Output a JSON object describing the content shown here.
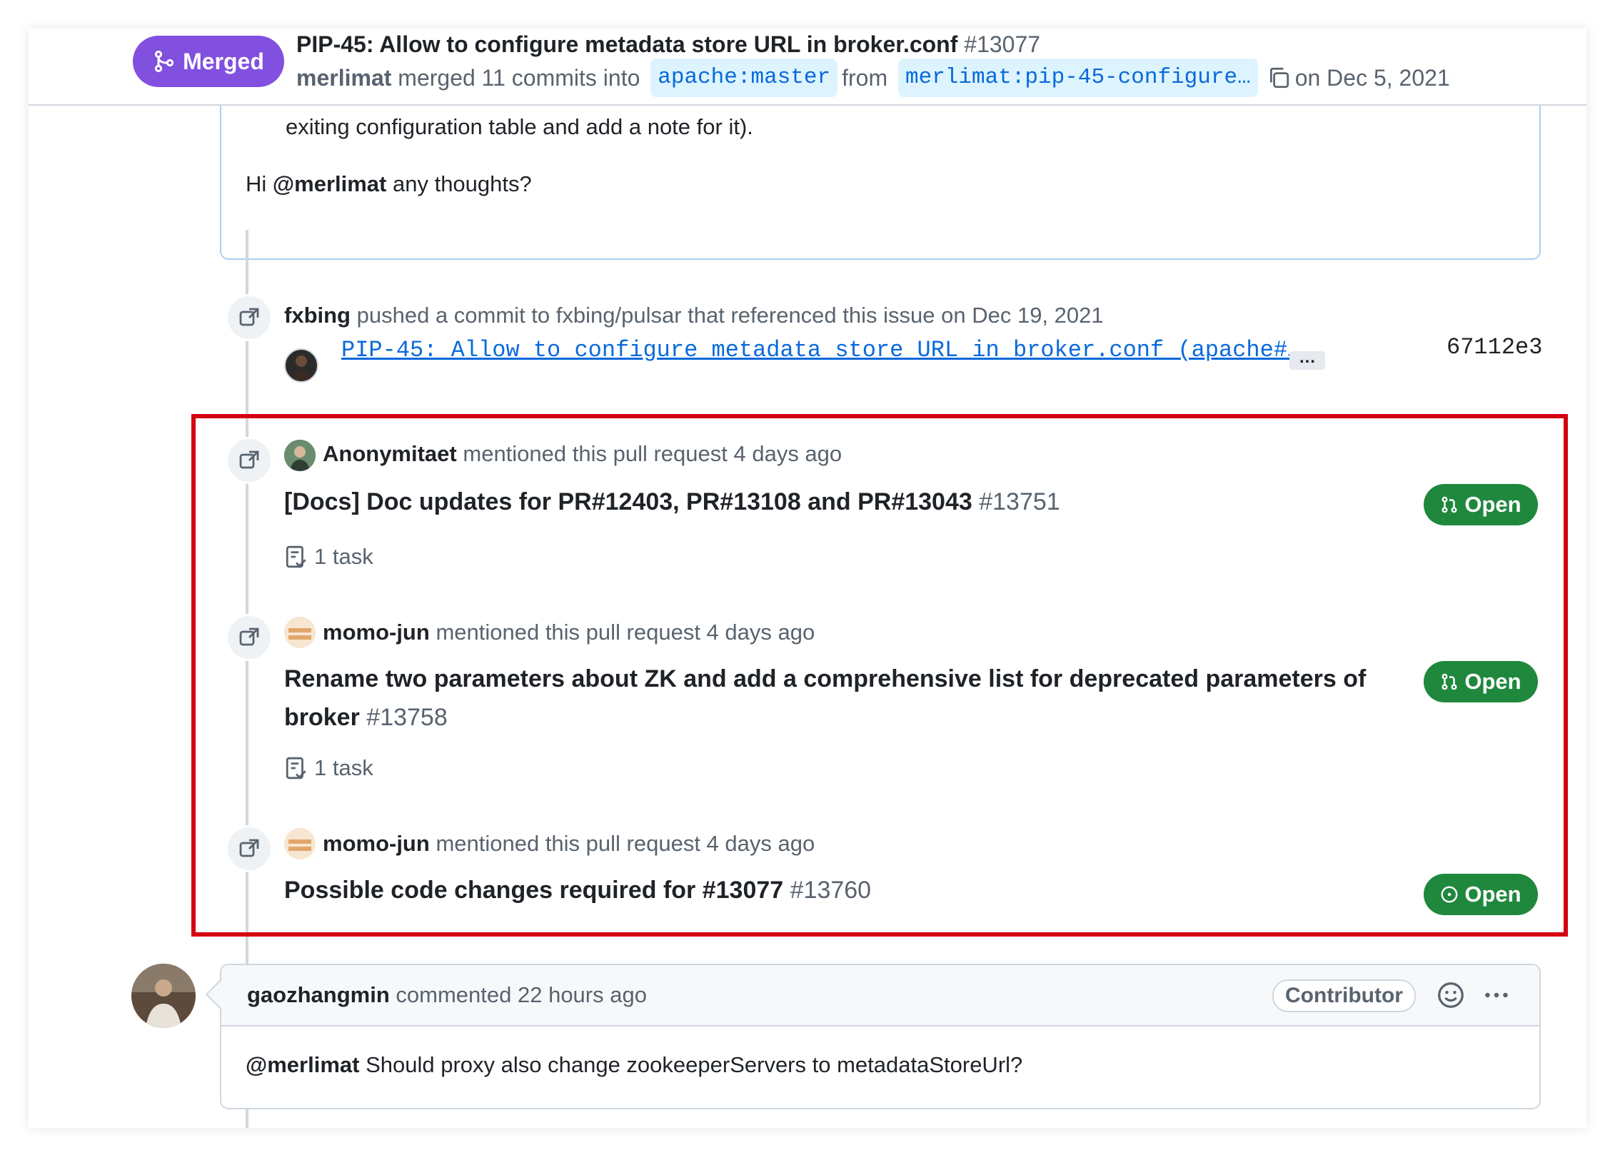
{
  "header": {
    "status_badge": "Merged",
    "title": "PIP-45: Allow to configure metadata store URL in broker.conf",
    "number": "#13077",
    "author": "merlimat",
    "merged_text": "merged 11 commits into",
    "base_branch": "apache:master",
    "from_text": "from",
    "head_branch": "merlimat:pip-45-configure…",
    "date_text": "on Dec 5, 2021"
  },
  "prev_comment": {
    "line1": "exiting configuration table and add a note for it).",
    "line2_prefix": "Hi",
    "line2_mention": "@merlimat",
    "line2_suffix": "any thoughts?"
  },
  "push_event": {
    "actor": "fxbing",
    "text": "pushed a commit to fxbing/pulsar that referenced this issue on Dec 19, 2021",
    "commit_message": "PIP-45: Allow to configure metadata store URL in broker.conf (apache#…",
    "ellipsis": "…",
    "sha": "67112e3"
  },
  "mentions": [
    {
      "actor": "Anonymitaet",
      "text": "mentioned this pull request 4 days ago",
      "pr_title": "[Docs] Doc updates for PR#12403, PR#13108 and PR#13043",
      "pr_number": "#13751",
      "task": "1 task",
      "status": "Open"
    },
    {
      "actor": "momo-jun",
      "text": "mentioned this pull request 4 days ago",
      "pr_title_line1": "Rename two parameters about ZK and add a comprehensive list for deprecated parameters of",
      "pr_title_line2": "broker",
      "pr_number": "#13758",
      "task": "1 task",
      "status": "Open"
    },
    {
      "actor": "momo-jun",
      "text": "mentioned this pull request 4 days ago",
      "pr_title": "Possible code changes required for #13077",
      "pr_number": "#13760",
      "status": "Open"
    }
  ],
  "comment": {
    "author": "gaozhangmin",
    "meta": "commented 22 hours ago",
    "role_badge": "Contributor",
    "mention": "@merlimat",
    "body": "Should proxy also change zookeeperServers to metadataStoreUrl?"
  },
  "colors": {
    "merged": "#8250df",
    "open": "#1f883d",
    "link": "#0969da",
    "highlight": "#d40010"
  }
}
